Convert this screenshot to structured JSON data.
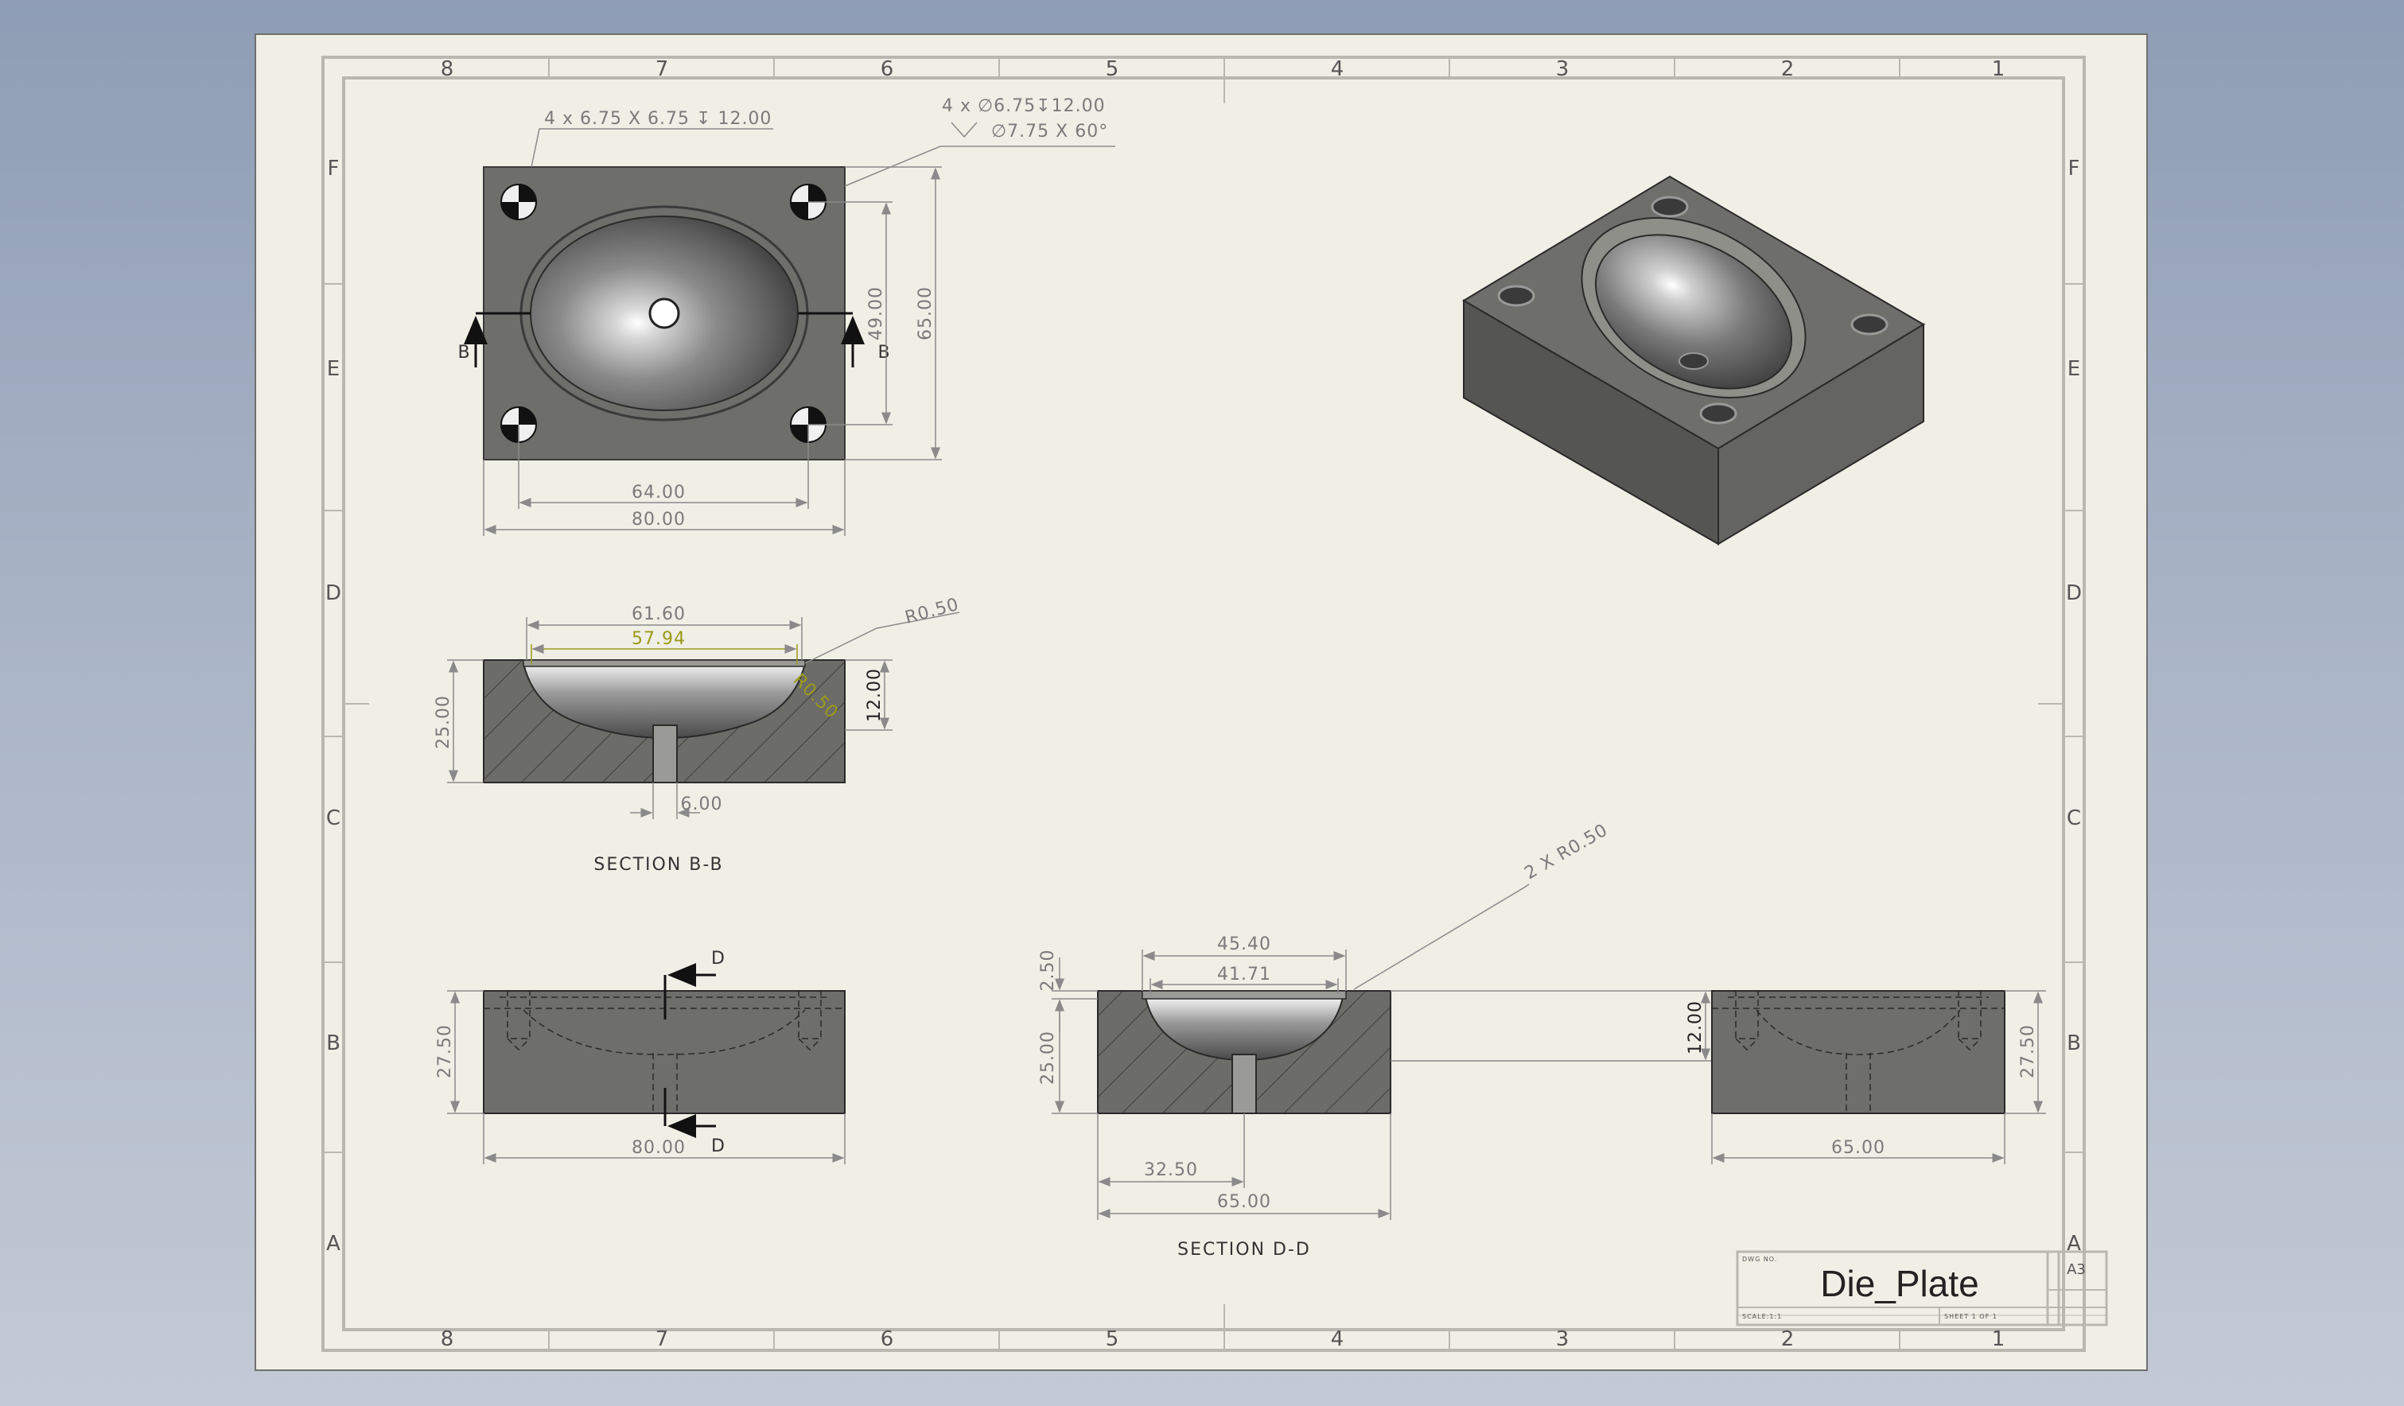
{
  "zones": {
    "columns": [
      "8",
      "7",
      "6",
      "5",
      "4",
      "3",
      "2",
      "1"
    ],
    "rows": [
      "F",
      "E",
      "D",
      "C",
      "B",
      "A"
    ]
  },
  "top_view": {
    "hole_callout_1": "4 x 6.75 X 6.75 ↧ 12.00",
    "hole_callout_2a": "4 x ∅6.75↧12.00",
    "hole_callout_2b": "∅7.75 X 60°",
    "dim_inner_width": "64.00",
    "dim_outer_width": "80.00",
    "dim_inner_height": "49.00",
    "dim_outer_height": "65.00",
    "section_marker": "B"
  },
  "section_bb": {
    "dim_top_outer": "61.60",
    "dim_top_inner": "57.94",
    "radius_callout": "R0.50",
    "radius_local": "R0.50",
    "dim_depth": "12.00",
    "dim_height": "25.00",
    "dim_hole": "6.00",
    "label": "SECTION B-B"
  },
  "front_view": {
    "dim_height": "27.50",
    "dim_width": "80.00",
    "section_marker": "D"
  },
  "section_dd": {
    "dim_top_outer": "45.40",
    "dim_top_inner": "41.71",
    "radius_callout": "2 X R0.50",
    "dim_lip": "2.50",
    "dim_height": "25.00",
    "dim_depth": "12.00",
    "dim_center": "32.50",
    "dim_width": "65.00",
    "label": "SECTION D-D"
  },
  "side_view": {
    "dim_height": "27.50",
    "dim_width": "65.00"
  },
  "title_block": {
    "dwg_no_label": "DWG NO.",
    "title": "Die_Plate",
    "size": "A3",
    "scale_label": "SCALE:1:1",
    "sheet_label": "SHEET 1 OF 1"
  },
  "colors": {
    "sheet": "#f0efe6",
    "part_face": "#6e6e6a",
    "highlight_dim": "#9a9a1a",
    "dim_line": "#8a8a8a"
  }
}
